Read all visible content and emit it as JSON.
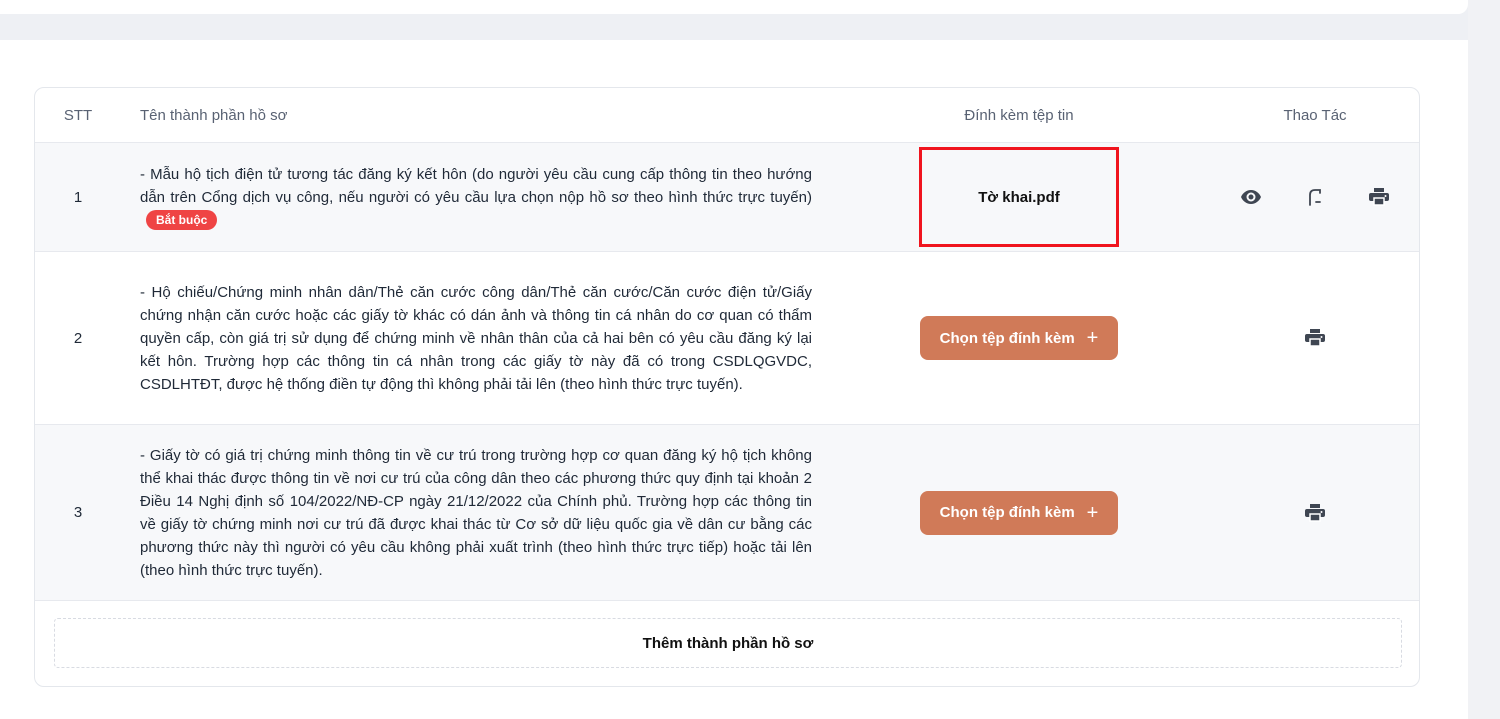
{
  "table": {
    "headers": {
      "stt": "STT",
      "name": "Tên thành phần hồ sơ",
      "attach": "Đính kèm tệp tin",
      "action": "Thao Tác"
    },
    "rows": [
      {
        "stt": "1",
        "description": "- Mẫu hộ tịch điện tử tương tác đăng ký kết hôn (do người yêu cầu cung cấp thông tin theo hướng dẫn trên Cổng dịch vụ công, nếu người có yêu cầu lựa chọn nộp hồ sơ theo hình thức trực tuyến)",
        "badge": "Bắt buộc",
        "attached_file": "Tờ khai.pdf",
        "actions": [
          "eye-icon",
          "edit-sign-icon",
          "print-icon"
        ]
      },
      {
        "stt": "2",
        "description": "- Hộ chiếu/Chứng minh nhân dân/Thẻ căn cước công dân/Thẻ căn cước/Căn cước điện tử/Giấy chứng nhận căn cước hoặc các giấy tờ khác có dán ảnh và thông tin cá nhân do cơ quan có thẩm quyền cấp, còn giá trị sử dụng để chứng minh về nhân thân của cả hai bên có yêu cầu đăng ký lại kết hôn. Trường hợp các thông tin cá nhân trong các giấy tờ này đã có trong CSDLQGVDC, CSDLHTĐT, được hệ thống điền tự động thì không phải tải lên (theo hình thức trực tuyến).",
        "button": "Chọn tệp đính kèm",
        "actions": [
          "print-icon"
        ]
      },
      {
        "stt": "3",
        "description": "- Giấy tờ có giá trị chứng minh thông tin về cư trú trong trường hợp cơ quan đăng ký hộ tịch không thể khai thác được thông tin về nơi cư trú của công dân theo các phương thức quy định tại khoản 2 Điều 14 Nghị định số 104/2022/NĐ-CP ngày 21/12/2022 của Chính phủ. Trường hợp các thông tin về giấy tờ chứng minh nơi cư trú đã được khai thác từ Cơ sở dữ liệu quốc gia về dân cư bằng các phương thức này thì người có yêu cầu không phải xuất trình (theo hình thức trực tiếp) hoặc tải lên (theo hình thức trực tuyến).",
        "button": "Chọn tệp đính kèm",
        "actions": [
          "print-icon"
        ]
      }
    ],
    "add_label": "Thêm thành phần hồ sơ"
  },
  "colors": {
    "accent_button": "#d07a58",
    "badge": "#ef4444",
    "highlight_border": "#f0141e",
    "icon": "#3f4652"
  }
}
